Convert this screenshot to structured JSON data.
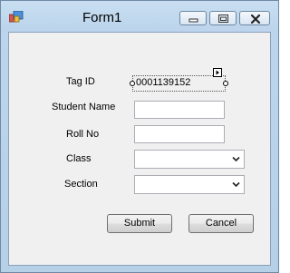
{
  "window": {
    "title": "Form1"
  },
  "form": {
    "tag_id": {
      "label": "Tag ID",
      "value": "0001139152"
    },
    "student_name": {
      "label": "Student Name",
      "value": ""
    },
    "roll_no": {
      "label": "Roll No",
      "value": ""
    },
    "class": {
      "label": "Class",
      "value": ""
    },
    "section": {
      "label": "Section",
      "value": ""
    }
  },
  "buttons": {
    "submit": "Submit",
    "cancel": "Cancel"
  },
  "icons": {
    "app": "app-icon",
    "minimize": "minimize-icon",
    "maximize": "maximize-icon",
    "close": "close-icon",
    "dropdown": "chevron-down-icon",
    "smart_tag": "smart-tag-icon"
  }
}
